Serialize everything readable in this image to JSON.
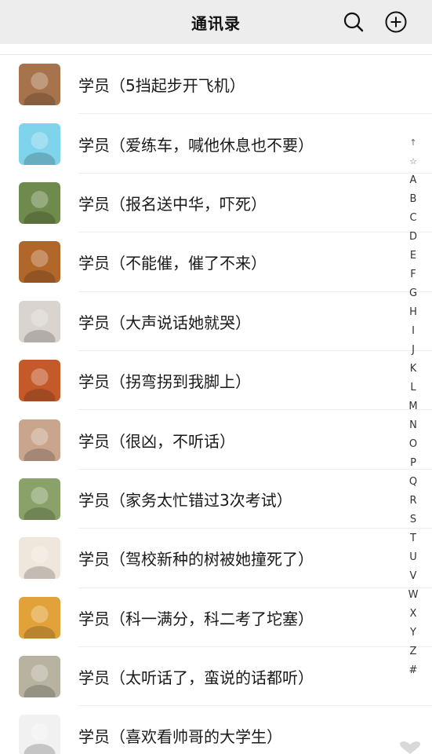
{
  "header": {
    "title": "通讯录",
    "icons": [
      "search-icon",
      "add-circle-icon"
    ]
  },
  "contacts": [
    {
      "name": "学员（5挡起步开飞机）",
      "avatar_color": "#a7734c"
    },
    {
      "name": "学员（爱练车，喊他休息也不要）",
      "avatar_color": "#7fd3ea"
    },
    {
      "name": "学员（报名送中华，吓死）",
      "avatar_color": "#6e8a4c"
    },
    {
      "name": "学员（不能催，催了不来）",
      "avatar_color": "#b2672a"
    },
    {
      "name": "学员（大声说话她就哭）",
      "avatar_color": "#d9d4cf"
    },
    {
      "name": "学员（拐弯拐到我脚上）",
      "avatar_color": "#c45a2a"
    },
    {
      "name": "学员（很凶，不听话）",
      "avatar_color": "#c9a58e"
    },
    {
      "name": "学员（家务太忙错过3次考试）",
      "avatar_color": "#8aa26a"
    },
    {
      "name": "学员（驾校新种的树被她撞死了）",
      "avatar_color": "#efe6dc"
    },
    {
      "name": "学员（科一满分，科二考了坨塞）",
      "avatar_color": "#e2a23a"
    },
    {
      "name": "学员（太听话了，蛮说的话都听）",
      "avatar_color": "#b8b2a0"
    },
    {
      "name": "学员（喜欢看帅哥的大学生）",
      "avatar_color": "#f1f1f1"
    }
  ],
  "index_bar": [
    "↑",
    "☆",
    "A",
    "B",
    "C",
    "D",
    "E",
    "F",
    "G",
    "H",
    "I",
    "J",
    "K",
    "L",
    "M",
    "N",
    "O",
    "P",
    "Q",
    "R",
    "S",
    "T",
    "U",
    "V",
    "W",
    "X",
    "Y",
    "Z",
    "#"
  ]
}
